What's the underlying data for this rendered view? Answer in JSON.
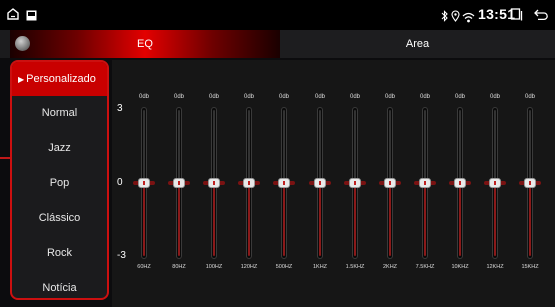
{
  "colors": {
    "accent": "#c90000",
    "track_lower": "#8b1a1a",
    "background": "#161616"
  },
  "status_bar": {
    "icons": [
      "home-icon",
      "gallery-icon",
      "bluetooth-icon",
      "location-icon",
      "wifi-icon",
      "recent-apps-icon",
      "back-icon"
    ],
    "time": "13:51"
  },
  "tabs": [
    {
      "label": "EQ",
      "active": true
    },
    {
      "label": "Area",
      "active": false
    }
  ],
  "presets": [
    "Personalizado",
    "Normal",
    "Jazz",
    "Pop",
    "Clássico",
    "Rock",
    "Notícia"
  ],
  "selected_preset": "Personalizado",
  "scale": {
    "top": "3",
    "mid": "0",
    "bottom": "-3"
  },
  "bands": [
    {
      "freq": "60HZ",
      "db": "0db",
      "value": 0
    },
    {
      "freq": "80HZ",
      "db": "0db",
      "value": 0
    },
    {
      "freq": "100HZ",
      "db": "0db",
      "value": 0
    },
    {
      "freq": "120HZ",
      "db": "0db",
      "value": 0
    },
    {
      "freq": "500HZ",
      "db": "0db",
      "value": 0
    },
    {
      "freq": "1KHZ",
      "db": "0db",
      "value": 0
    },
    {
      "freq": "1.5KHZ",
      "db": "0db",
      "value": 0
    },
    {
      "freq": "2KHZ",
      "db": "0db",
      "value": 0
    },
    {
      "freq": "7.5KHZ",
      "db": "0db",
      "value": 0
    },
    {
      "freq": "10KHZ",
      "db": "0db",
      "value": 0
    },
    {
      "freq": "12KHZ",
      "db": "0db",
      "value": 0
    },
    {
      "freq": "15KHZ",
      "db": "0db",
      "value": 0
    }
  ]
}
